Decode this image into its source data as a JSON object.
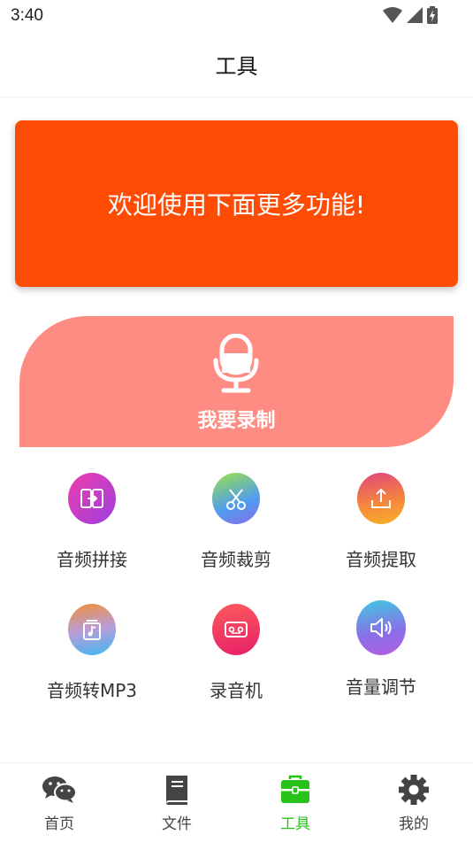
{
  "status_bar": {
    "time": "3:40"
  },
  "header": {
    "title": "工具"
  },
  "banner": {
    "text": "欢迎使用下面更多功能!",
    "color": "#ff4c05"
  },
  "record": {
    "label": "我要录制",
    "color": "#ff8c82"
  },
  "tools": [
    {
      "label": "音频拼接",
      "icon": "audio-join-icon"
    },
    {
      "label": "音频裁剪",
      "icon": "scissors-icon"
    },
    {
      "label": "音频提取",
      "icon": "extract-icon"
    },
    {
      "label": "音频转MP3",
      "icon": "music-file-icon"
    },
    {
      "label": "录音机",
      "icon": "recorder-icon"
    },
    {
      "label": "音量调节",
      "icon": "volume-icon"
    }
  ],
  "bottom_nav": {
    "active_color": "#27c21a",
    "items": [
      {
        "label": "首页",
        "icon": "chat-icon"
      },
      {
        "label": "文件",
        "icon": "book-icon"
      },
      {
        "label": "工具",
        "icon": "toolbox-icon",
        "active": true
      },
      {
        "label": "我的",
        "icon": "gear-icon"
      }
    ]
  }
}
